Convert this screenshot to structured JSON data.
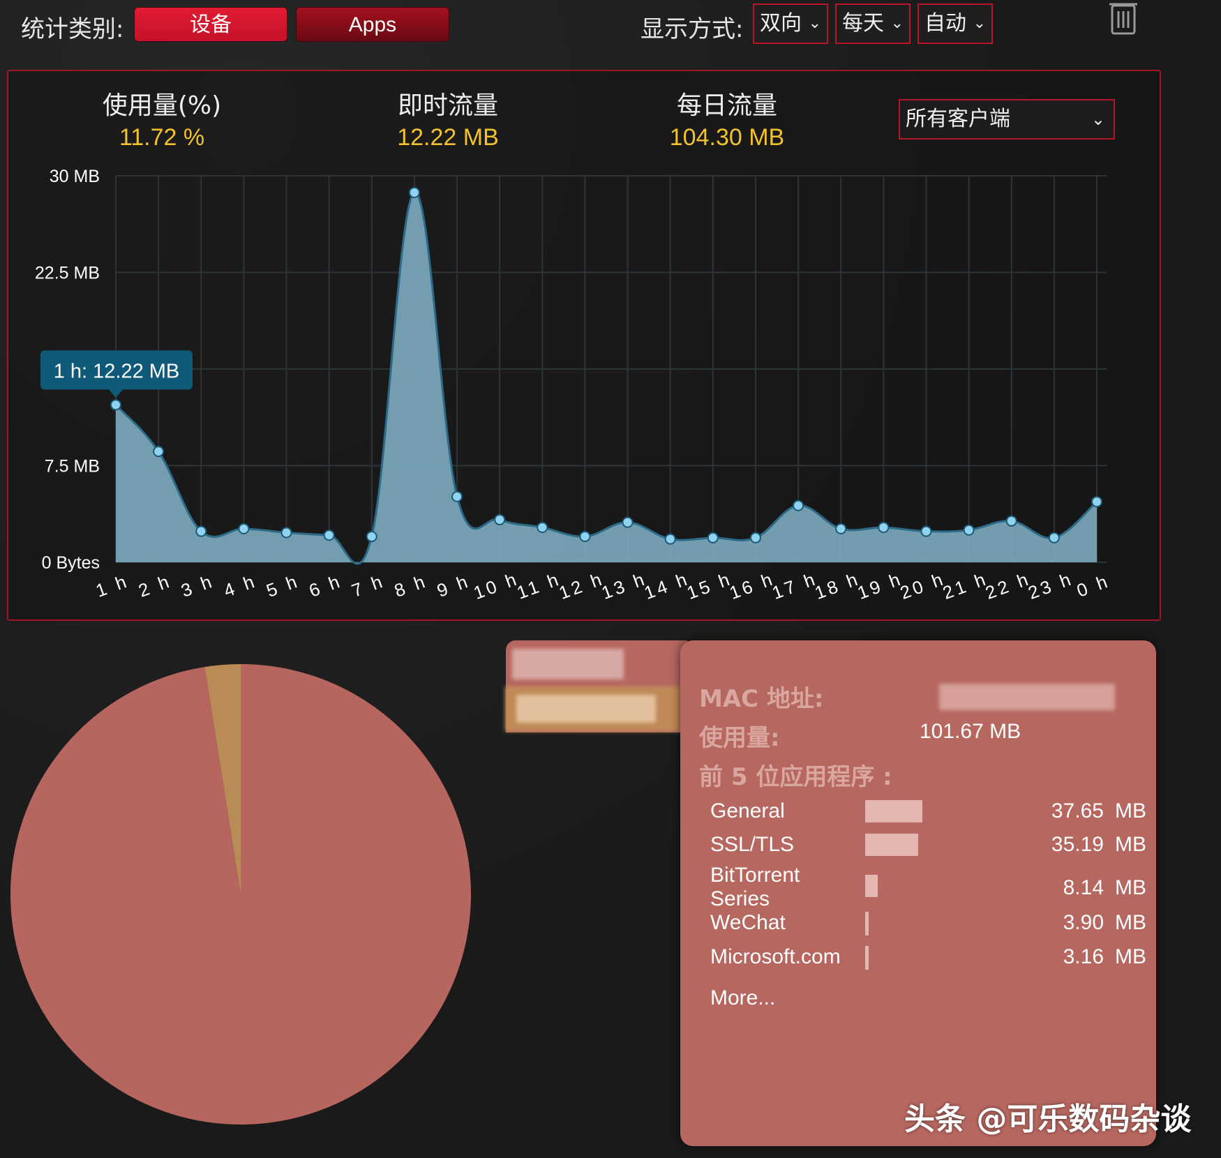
{
  "topbar": {
    "category_label": "统计类别:",
    "tab_devices": "设备",
    "tab_apps": "Apps",
    "display_label": "显示方式:",
    "direction": "双向",
    "period": "每天",
    "refresh": "自动"
  },
  "stats": {
    "usage_title": "使用量(%)",
    "usage_value": "11.72 %",
    "realtime_title": "即时流量",
    "realtime_value": "12.22 MB",
    "daily_title": "每日流量",
    "daily_value": "104.30 MB",
    "client_select": "所有客户端"
  },
  "tooltip": "1 h: 12.22 MB",
  "chart_data": {
    "type": "area",
    "x": [
      "1 h",
      "2 h",
      "3 h",
      "4 h",
      "5 h",
      "6 h",
      "7 h",
      "8 h",
      "9 h",
      "10 h",
      "11 h",
      "12 h",
      "13 h",
      "14 h",
      "15 h",
      "16 h",
      "17 h",
      "18 h",
      "19 h",
      "20 h",
      "21 h",
      "22 h",
      "23 h",
      "0 h"
    ],
    "values": [
      12.22,
      8.6,
      2.4,
      2.6,
      2.3,
      2.1,
      2.0,
      28.7,
      5.1,
      3.3,
      2.7,
      2.0,
      3.1,
      1.8,
      1.9,
      1.9,
      4.4,
      2.6,
      2.7,
      2.4,
      2.5,
      3.2,
      1.9,
      4.7
    ],
    "y_tick_labels": [
      "0 Bytes",
      "7.5 MB",
      "22.5 MB",
      "30 MB"
    ],
    "y_tick_values": [
      0,
      7.5,
      22.5,
      30
    ],
    "ylim": [
      0,
      30
    ],
    "grid": true,
    "fill_color": "#7ca9bd",
    "line_color": "#2c6b88",
    "point_color": "#8fd3f0"
  },
  "pie": {
    "slices": [
      {
        "value": 97.5,
        "color": "#b6665e"
      },
      {
        "value": 2.5,
        "color": "#b98b55"
      }
    ]
  },
  "card": {
    "mac_label": "MAC 地址:",
    "usage_label": "使用量:",
    "usage_value": "101.67 MB",
    "top5_label": "前 5 位应用程序 :",
    "apps": [
      {
        "name": "General",
        "value": "37.65",
        "unit": "MB",
        "share": 1.0
      },
      {
        "name": "SSL/TLS",
        "value": "35.19",
        "unit": "MB",
        "share": 0.93
      },
      {
        "name": "BitTorrent Series",
        "value": "8.14",
        "unit": "MB",
        "share": 0.22
      },
      {
        "name": "WeChat",
        "value": "3.90",
        "unit": "MB",
        "share": 0.06
      },
      {
        "name": "Microsoft.com",
        "value": "3.16",
        "unit": "MB",
        "share": 0.06
      }
    ],
    "more": "More..."
  },
  "watermark": "头条 @可乐数码杂谈",
  "colors": {
    "accent": "#c4122a",
    "value_yellow": "#f2c12e",
    "card_bg": "#b6675f"
  }
}
